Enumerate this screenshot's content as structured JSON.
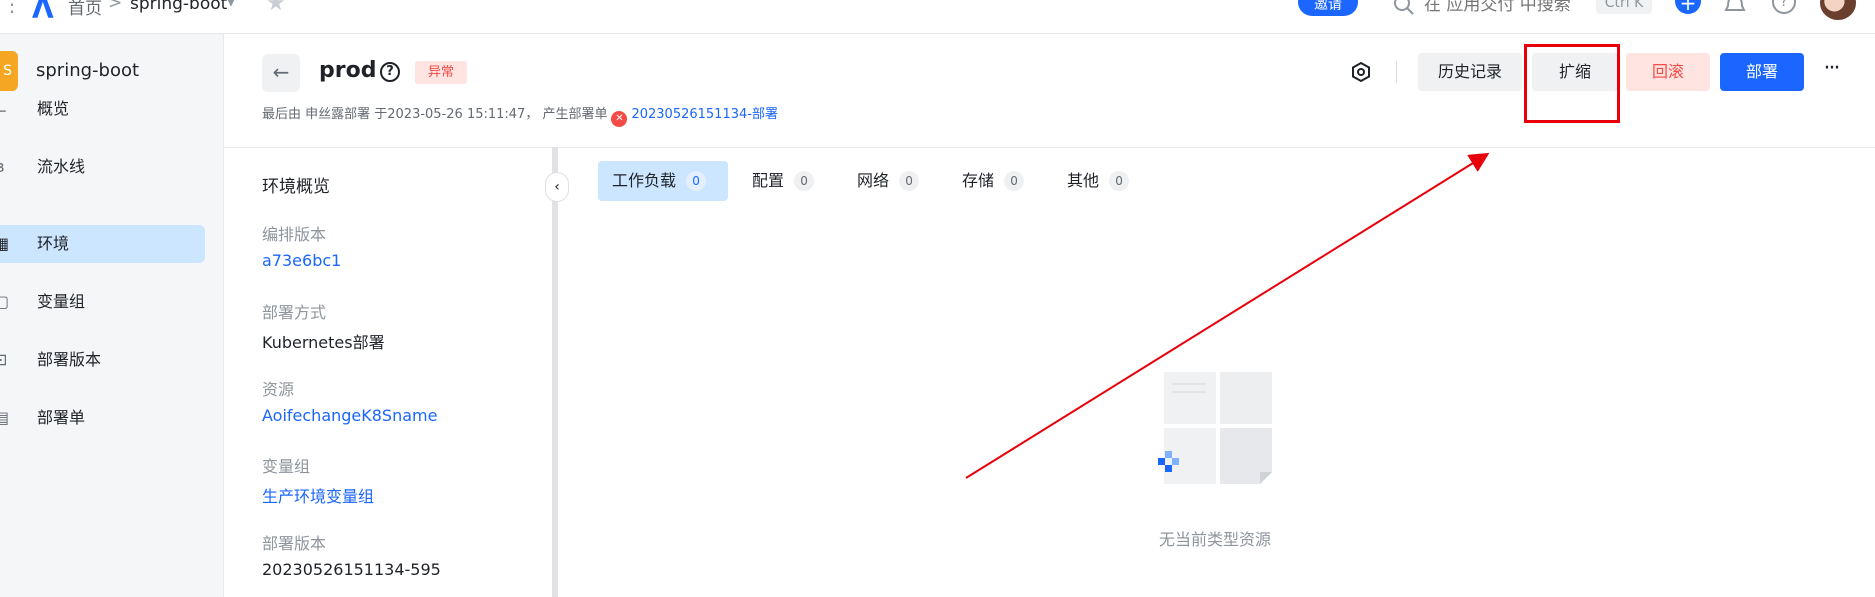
{
  "topbar": {
    "home": "首页",
    "separator": ">",
    "app": "spring-boot",
    "invite": "邀请",
    "search_placeholder": "在 应用交付 中搜索",
    "shortcut": "Ctrl K"
  },
  "sidebar": {
    "app_badge": "S",
    "app_name": "spring-boot",
    "items": [
      {
        "label": "概览",
        "icon": "chart-icon"
      },
      {
        "label": "流水线",
        "icon": "pipeline-icon"
      },
      {
        "label": "环境",
        "icon": "environment-icon",
        "active": true
      },
      {
        "label": "变量组",
        "icon": "variable-icon"
      },
      {
        "label": "部署版本",
        "icon": "version-icon"
      },
      {
        "label": "部署单",
        "icon": "order-icon"
      }
    ]
  },
  "header": {
    "env_name": "prod",
    "status": "异常",
    "meta_prefix": "最后由 申丝露部署 于2023-05-26 15:11:47， 产生部署单",
    "meta_link": "20230526151134-部署",
    "buttons": {
      "history": "历史记录",
      "scale": "扩缩",
      "rollback": "回滚",
      "deploy": "部署"
    }
  },
  "details": {
    "title": "环境概览",
    "fields": [
      {
        "label": "编排版本",
        "value": "a73e6bc1"
      },
      {
        "label": "部署方式",
        "value": "Kubernetes部署"
      },
      {
        "label": "资源",
        "value": "AoifechangeK8Sname"
      },
      {
        "label": "变量组",
        "value": "生产环境变量组"
      },
      {
        "label": "部署版本",
        "value": "20230526151134-595"
      }
    ]
  },
  "tabs": [
    {
      "label": "工作负载",
      "count": "0"
    },
    {
      "label": "配置",
      "count": "0"
    },
    {
      "label": "网络",
      "count": "0"
    },
    {
      "label": "存储",
      "count": "0"
    },
    {
      "label": "其他",
      "count": "0"
    }
  ],
  "empty_state": "无当前类型资源",
  "colors": {
    "primary": "#1a66ff",
    "danger": "#f54a45",
    "active_bg": "#cce6ff",
    "annotation": "#e8000b"
  }
}
